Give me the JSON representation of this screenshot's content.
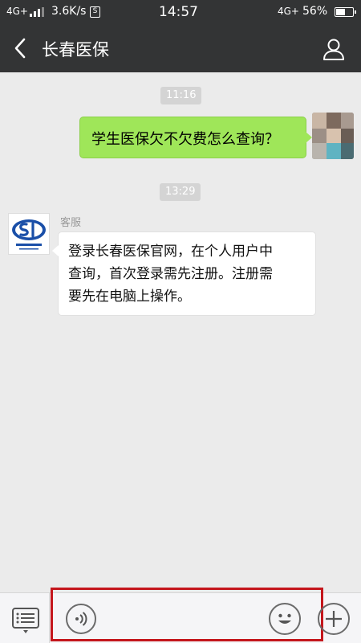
{
  "status_bar": {
    "network_left": "4G+",
    "net_speed": "3.6K/s",
    "badge": "S",
    "time": "14:57",
    "network_right": "4G+",
    "battery_percent": "56%",
    "battery_level": 0.56
  },
  "header": {
    "title": "长春医保",
    "back_icon": "chevron-left-icon",
    "profile_icon": "person-icon"
  },
  "messages": [
    {
      "type": "timestamp",
      "text": "11:16"
    },
    {
      "type": "outgoing",
      "text": "学生医保欠不欠费怎么查询？"
    },
    {
      "type": "timestamp",
      "text": "13:29"
    },
    {
      "type": "incoming",
      "sender": "客服",
      "lines": [
        "登录长春医保官网，在个人用户中",
        "查询，首次登录需先注册。注册需",
        "要先在电脑上操作。"
      ]
    }
  ],
  "bottom_bar": {
    "menu_icon": "menu-list-icon",
    "voice_icon": "voice-icon",
    "emoji_icon": "emoji-icon",
    "plus_icon": "plus-icon"
  },
  "colors": {
    "header_bg": "#333435",
    "chat_bg": "#ebebeb",
    "outgoing_bubble": "#9fe659",
    "highlight": "#c4161c"
  }
}
